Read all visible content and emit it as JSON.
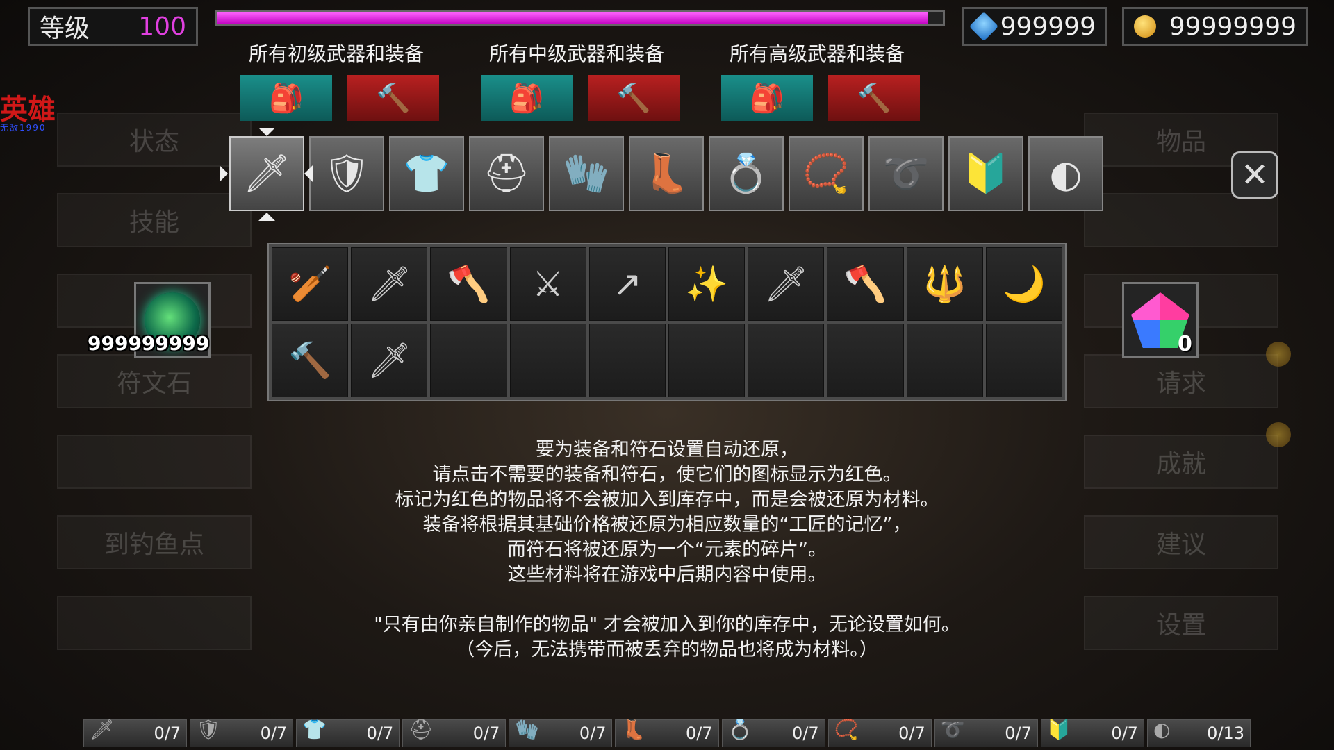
{
  "top": {
    "level_label": "等级",
    "level_value": "100",
    "xp_percent": 98,
    "gems": "999999",
    "gold": "99999999"
  },
  "categories": [
    {
      "label": "所有初级武器和装备",
      "buttons": [
        "bag-icon",
        "hammer-icon"
      ]
    },
    {
      "label": "所有中级武器和装备",
      "buttons": [
        "bag-icon",
        "hammer-icon"
      ]
    },
    {
      "label": "所有高级武器和装备",
      "buttons": [
        "bag-icon",
        "hammer-icon"
      ]
    }
  ],
  "logo": {
    "title": "英雄",
    "subtitle": "无敌1990"
  },
  "left_menu": [
    "状态",
    "技能",
    "",
    "符文石",
    "",
    "到钓鱼点",
    ""
  ],
  "right_menu": [
    "物品",
    "",
    "",
    "请求",
    "成就",
    "建议",
    "设置"
  ],
  "equipment_tabs": [
    {
      "icon": "sword-icon",
      "glyph": "🗡"
    },
    {
      "icon": "shield-icon",
      "glyph": "🛡"
    },
    {
      "icon": "armor-icon",
      "glyph": "👕"
    },
    {
      "icon": "helmet-icon",
      "glyph": "⛑"
    },
    {
      "icon": "gloves-icon",
      "glyph": "🧤"
    },
    {
      "icon": "boots-icon",
      "glyph": "👢"
    },
    {
      "icon": "ring-icon",
      "glyph": "💍"
    },
    {
      "icon": "amulet-icon",
      "glyph": "📿"
    },
    {
      "icon": "belt-icon",
      "glyph": "➰"
    },
    {
      "icon": "cape-icon",
      "glyph": "🔰"
    },
    {
      "icon": "rune-icon",
      "glyph": "◐"
    }
  ],
  "grid_items": [
    {
      "icon": "club-icon",
      "glyph": "🏏"
    },
    {
      "icon": "dagger-icon",
      "glyph": "🗡"
    },
    {
      "icon": "axe-icon",
      "glyph": "🪓"
    },
    {
      "icon": "scimitar-icon",
      "glyph": "⚔"
    },
    {
      "icon": "spear-icon",
      "glyph": "↗"
    },
    {
      "icon": "wand-icon",
      "glyph": "✨"
    },
    {
      "icon": "sword-icon",
      "glyph": "🗡"
    },
    {
      "icon": "battle-axe-icon",
      "glyph": "🪓"
    },
    {
      "icon": "staff-icon",
      "glyph": "🔱"
    },
    {
      "icon": "claw-icon",
      "glyph": "🌙"
    },
    {
      "icon": "warhammer-icon",
      "glyph": "🔨"
    },
    {
      "icon": "crystal-sword-icon",
      "glyph": "🗡"
    },
    {
      "icon": "",
      "glyph": ""
    },
    {
      "icon": "",
      "glyph": ""
    },
    {
      "icon": "",
      "glyph": ""
    },
    {
      "icon": "",
      "glyph": ""
    },
    {
      "icon": "",
      "glyph": ""
    },
    {
      "icon": "",
      "glyph": ""
    },
    {
      "icon": "",
      "glyph": ""
    },
    {
      "icon": "",
      "glyph": ""
    }
  ],
  "rune_count": "999999999",
  "crystal_count": "0",
  "info_lines": [
    "要为装备和符石设置自动还原，",
    "请点击不需要的装备和符石，使它们的图标显示为红色。",
    "标记为红色的物品将不会被加入到库存中，而是会被还原为材料。",
    "装备将根据其基础价格被还原为相应数量的“工匠的记忆”，",
    "而符石将被还原为一个“元素的碎片”。",
    "这些材料将在游戏中后期内容中使用。"
  ],
  "info_lines_2": [
    "\"只有由你亲自制作的物品\" 才会被加入到你的库存中，无论设置如何。",
    "（今后，无法携带而被丢弃的物品也将成为材料。）"
  ],
  "bottom_counters": [
    {
      "icon": "sword-icon",
      "glyph": "🗡",
      "value": "0/7"
    },
    {
      "icon": "shield-icon",
      "glyph": "🛡",
      "value": "0/7"
    },
    {
      "icon": "armor-icon",
      "glyph": "👕",
      "value": "0/7"
    },
    {
      "icon": "helmet-icon",
      "glyph": "⛑",
      "value": "0/7"
    },
    {
      "icon": "gloves-icon",
      "glyph": "🧤",
      "value": "0/7"
    },
    {
      "icon": "boots-icon",
      "glyph": "👢",
      "value": "0/7"
    },
    {
      "icon": "ring-icon",
      "glyph": "💍",
      "value": "0/7"
    },
    {
      "icon": "amulet-icon",
      "glyph": "📿",
      "value": "0/7"
    },
    {
      "icon": "belt-icon",
      "glyph": "➰",
      "value": "0/7"
    },
    {
      "icon": "cape-icon",
      "glyph": "🔰",
      "value": "0/7"
    },
    {
      "icon": "rune-icon",
      "glyph": "◐",
      "value": "0/13"
    }
  ],
  "colors": {
    "level_value": "#e040e0",
    "xp_bar": "#ff44ff",
    "teal_button": "#1a8f8a",
    "red_button": "#b82020",
    "logo": "#d01818"
  }
}
